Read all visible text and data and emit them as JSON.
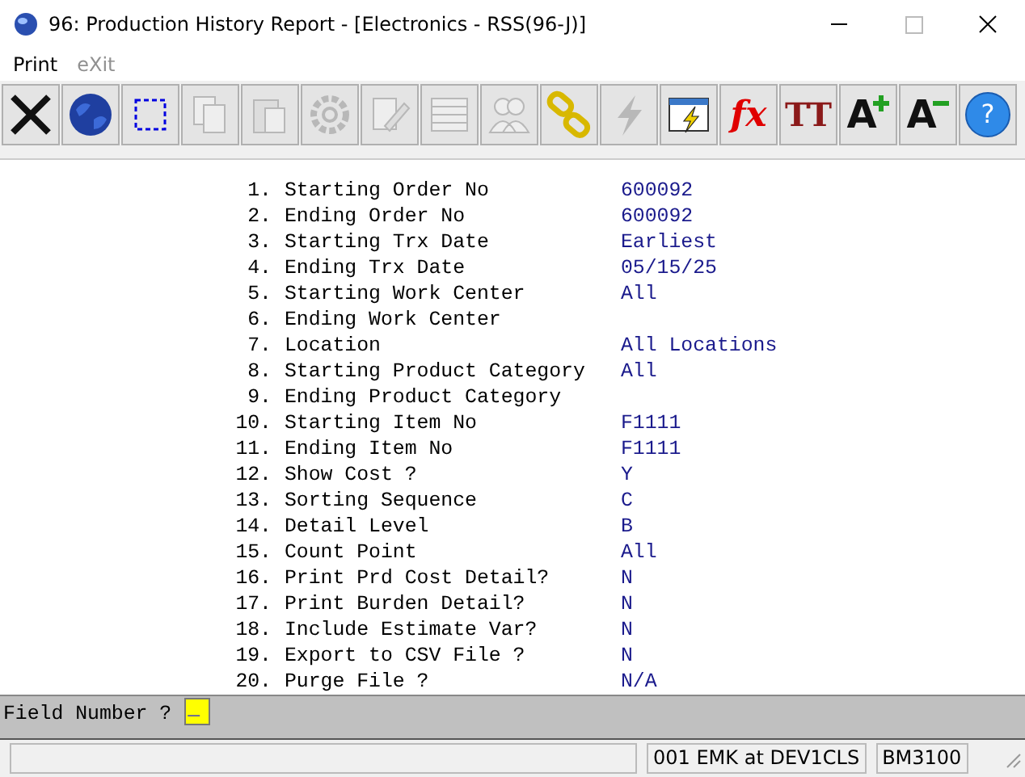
{
  "window": {
    "title": "96: Production History Report - [Electronics - RSS(96-J)]"
  },
  "menu": [
    {
      "label": "Print",
      "disabled": false
    },
    {
      "label": "eXit",
      "disabled": true
    }
  ],
  "toolbar": [
    {
      "kind": "close",
      "disabled": false
    },
    {
      "kind": "globe",
      "disabled": false
    },
    {
      "kind": "select",
      "disabled": false
    },
    {
      "kind": "copy",
      "disabled": true
    },
    {
      "kind": "paste",
      "disabled": true
    },
    {
      "kind": "gear",
      "disabled": true
    },
    {
      "kind": "edit",
      "disabled": true
    },
    {
      "kind": "table",
      "disabled": true
    },
    {
      "kind": "users",
      "disabled": true
    },
    {
      "kind": "chain",
      "disabled": false
    },
    {
      "kind": "bolt",
      "disabled": true
    },
    {
      "kind": "window-bolt",
      "disabled": false
    },
    {
      "kind": "fx",
      "glyph": "fx",
      "disabled": false
    },
    {
      "kind": "tt",
      "glyph": "TT",
      "disabled": false
    },
    {
      "kind": "font-up",
      "glyph": "A",
      "disabled": false
    },
    {
      "kind": "font-down",
      "glyph": "A",
      "disabled": false
    },
    {
      "kind": "help",
      "glyph": "?",
      "disabled": false
    }
  ],
  "fields": [
    {
      "number": "1.",
      "label": "Starting Order No",
      "value": "600092"
    },
    {
      "number": "2.",
      "label": "Ending Order No",
      "value": "600092"
    },
    {
      "number": "3.",
      "label": "Starting Trx Date",
      "value": "Earliest"
    },
    {
      "number": "4.",
      "label": "Ending Trx Date",
      "value": "05/15/25"
    },
    {
      "number": "5.",
      "label": "Starting Work Center",
      "value": "All"
    },
    {
      "number": "6.",
      "label": "Ending Work Center"
    },
    {
      "number": "7.",
      "label": "Location",
      "value": "All Locations"
    },
    {
      "number": "8.",
      "label": "Starting Product Category",
      "value": "All"
    },
    {
      "number": "9.",
      "label": "Ending Product Category"
    },
    {
      "number": "10.",
      "label": "Starting Item No",
      "value": "F1111"
    },
    {
      "number": "11.",
      "label": "Ending Item No",
      "value": "F1111"
    },
    {
      "number": "12.",
      "label": "Show Cost ?",
      "value": "Y"
    },
    {
      "number": "13.",
      "label": "Sorting Sequence",
      "value": "C"
    },
    {
      "number": "14.",
      "label": "Detail Level",
      "value": "B"
    },
    {
      "number": "15.",
      "label": "Count Point",
      "value": "All"
    },
    {
      "number": "16.",
      "label": "Print Prd Cost Detail?",
      "value": "N"
    },
    {
      "number": "17.",
      "label": "Print Burden Detail?",
      "value": "N"
    },
    {
      "number": "18.",
      "label": "Include Estimate Var?",
      "value": "N"
    },
    {
      "number": "19.",
      "label": "Export to CSV File ?",
      "value": "N"
    },
    {
      "number": "20.",
      "label": "Purge File ?",
      "value": "N/A"
    }
  ],
  "prompt": {
    "label": "Field Number ?",
    "cursor": "_"
  },
  "status_bar": [
    "001 EMK at DEV1CLS",
    "BM3100"
  ]
}
